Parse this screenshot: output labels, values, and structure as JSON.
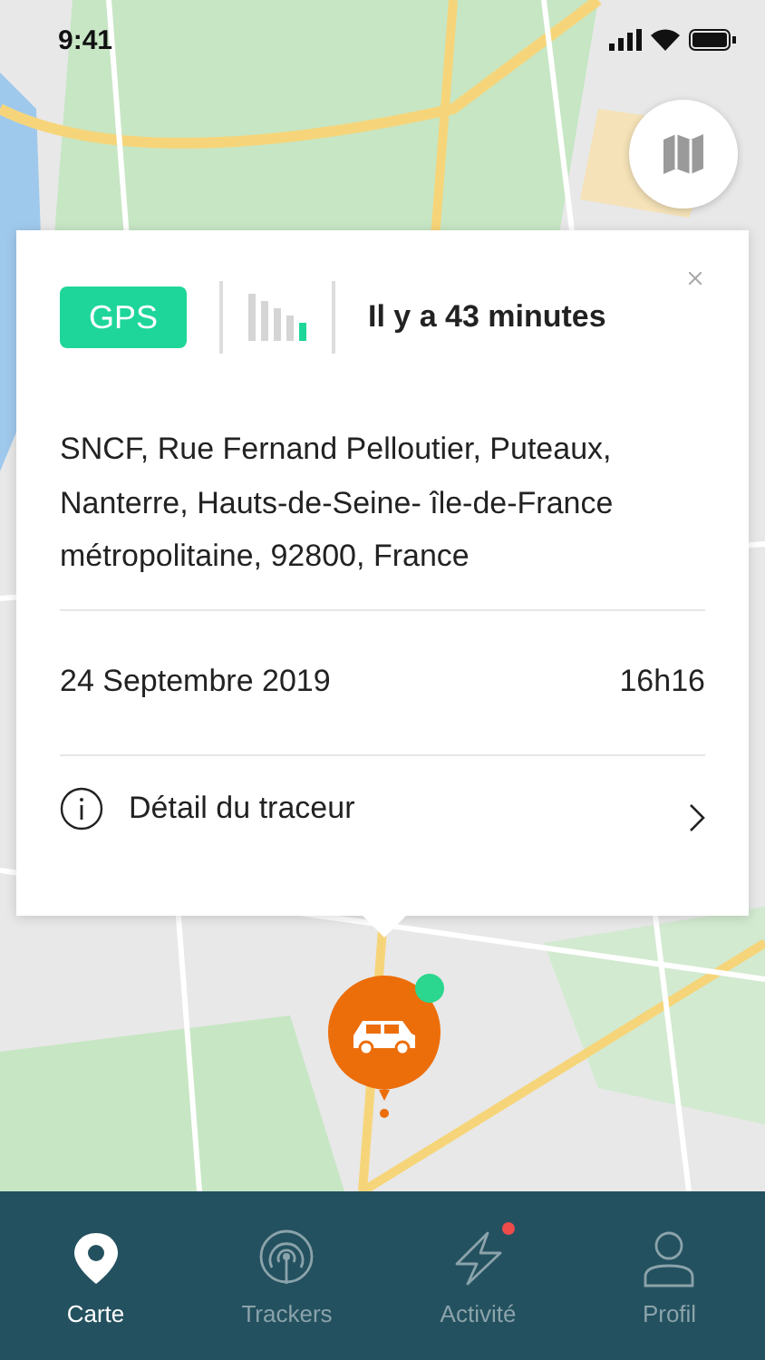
{
  "status_bar": {
    "time": "9:41"
  },
  "card": {
    "source": "GPS",
    "last_seen": "Il y a 43 minutes",
    "address": "SNCF, Rue Fernand Pelloutier, Puteaux, Nanterre, Hauts-de-Seine- île-de-France métropolitaine, 92800, France",
    "date": "24 Septembre 2019",
    "time": "16h16",
    "detail_link": "Détail du traceur"
  },
  "tabs": [
    {
      "label": "Carte",
      "kind": "pin",
      "selected": true,
      "badge": false
    },
    {
      "label": "Trackers",
      "kind": "antenna",
      "selected": false,
      "badge": false
    },
    {
      "label": "Activité",
      "kind": "bolt",
      "selected": false,
      "badge": true
    },
    {
      "label": "Profil",
      "kind": "person",
      "selected": false,
      "badge": false
    }
  ]
}
